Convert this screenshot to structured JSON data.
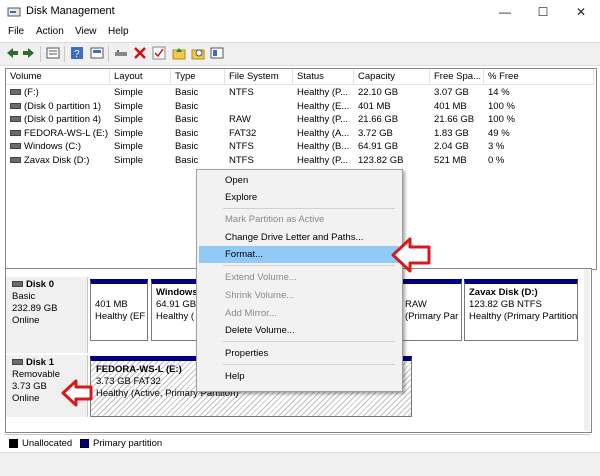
{
  "window": {
    "title": "Disk Management",
    "controls": {
      "minimize": "—",
      "maximize": "☐",
      "close": "✕"
    }
  },
  "menu": [
    "File",
    "Action",
    "View",
    "Help"
  ],
  "volume_table": {
    "columns": [
      "Volume",
      "Layout",
      "Type",
      "File System",
      "Status",
      "Capacity",
      "Free Spa...",
      "% Free"
    ],
    "rows": [
      [
        "(F:)",
        "Simple",
        "Basic",
        "NTFS",
        "Healthy (P...",
        "22.10 GB",
        "3.07 GB",
        "14 %"
      ],
      [
        "(Disk 0 partition 1)",
        "Simple",
        "Basic",
        "",
        "Healthy (E...",
        "401 MB",
        "401 MB",
        "100 %"
      ],
      [
        "(Disk 0 partition 4)",
        "Simple",
        "Basic",
        "RAW",
        "Healthy (P...",
        "21.66 GB",
        "21.66 GB",
        "100 %"
      ],
      [
        "FEDORA-WS-L (E:)",
        "Simple",
        "Basic",
        "FAT32",
        "Healthy (A...",
        "3.72 GB",
        "1.83 GB",
        "49 %"
      ],
      [
        "Windows (C:)",
        "Simple",
        "Basic",
        "NTFS",
        "Healthy (B...",
        "64.91 GB",
        "2.04 GB",
        "3 %"
      ],
      [
        "Zavax Disk (D:)",
        "Simple",
        "Basic",
        "NTFS",
        "Healthy (P...",
        "123.82 GB",
        "521 MB",
        "0 %"
      ]
    ]
  },
  "context_menu": {
    "items": [
      {
        "label": "Open",
        "enabled": true
      },
      {
        "label": "Explore",
        "enabled": true
      },
      {
        "label": "Mark Partition as Active",
        "enabled": false
      },
      {
        "label": "Change Drive Letter and Paths...",
        "enabled": true
      },
      {
        "label": "Format...",
        "enabled": true,
        "highlighted": true
      },
      {
        "label": "Extend Volume...",
        "enabled": false
      },
      {
        "label": "Shrink Volume...",
        "enabled": false
      },
      {
        "label": "Add Mirror...",
        "enabled": false
      },
      {
        "label": "Delete Volume...",
        "enabled": true
      },
      {
        "label": "Properties",
        "enabled": true
      },
      {
        "label": "Help",
        "enabled": true
      }
    ]
  },
  "disks": [
    {
      "name": "Disk 0",
      "type": "Basic",
      "size": "232.89 GB",
      "status": "Online",
      "partitions": [
        {
          "name": "",
          "line1": "401 MB",
          "line2": "Healthy (EF"
        },
        {
          "name": "Windows",
          "line1": "64.91 GB",
          "line2": "Healthy ("
        },
        {
          "name": "",
          "line1": "RAW",
          "line2": "(Primary Par"
        },
        {
          "name": "Zavax Disk  (D:)",
          "line1": "123.82 GB NTFS",
          "line2": "Healthy (Primary Partition"
        }
      ]
    },
    {
      "name": "Disk 1",
      "type": "Removable",
      "size": "3.73 GB",
      "status": "Online",
      "partitions": [
        {
          "name": "FEDORA-WS-L  (E:)",
          "line1": "3.73 GB FAT32",
          "line2": "Healthy (Active, Primary Partition)"
        }
      ]
    }
  ],
  "legend": [
    {
      "label": "Unallocated",
      "color": "#000000"
    },
    {
      "label": "Primary partition",
      "color": "#00007f"
    }
  ],
  "colors": {
    "primary_partition": "#00007f",
    "highlight": "#91c9f7",
    "annotation_arrow": "#d7191c"
  }
}
